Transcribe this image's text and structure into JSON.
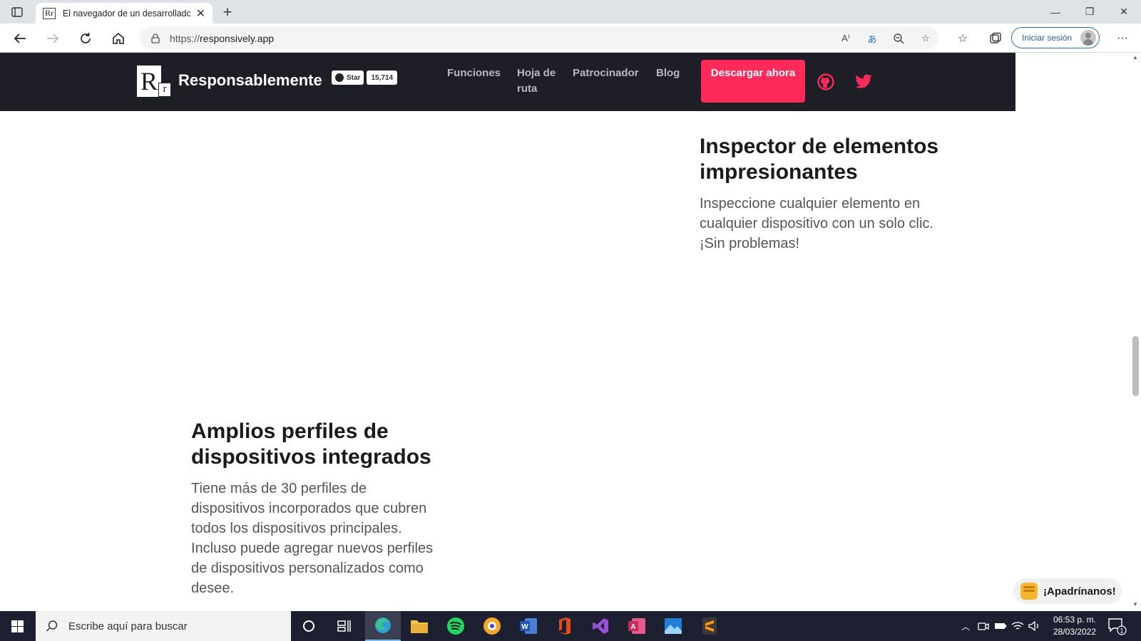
{
  "browser": {
    "tab_title": "El navegador de un desarrollador",
    "url_prefix": "https://",
    "url_host": "responsively.app",
    "signin_label": "Iniciar sesión"
  },
  "site": {
    "brand": "Responsablemente",
    "logo_big": "R",
    "logo_small": "r",
    "star_label": "Star",
    "star_count": "15,714",
    "nav": [
      {
        "label": "Funciones"
      },
      {
        "label": "Hoja de ruta"
      },
      {
        "label": "Patrocinador"
      },
      {
        "label": "Blog"
      }
    ],
    "cta_label": "Descargar ahora"
  },
  "features": [
    {
      "title": "Inspector de elementos impresionantes",
      "text": "Inspeccione cualquier elemento en cualquier dispositivo con un solo clic. ¡Sin problemas!"
    },
    {
      "title": "Amplios perfiles de dispositivos integrados",
      "text": "Tiene más de 30 perfiles de dispositivos incorporados que cubren todos los dispositivos principales. Incluso puede agregar nuevos perfiles de dispositivos personalizados como desee."
    }
  ],
  "sponsor_label": "¡Apadrínanos!",
  "taskbar": {
    "search_placeholder": "Escribe aquí para buscar",
    "time": "06:53 p. m.",
    "date": "28/03/2022",
    "notification_count": "1"
  },
  "colors": {
    "header_bg": "#1e1e27",
    "cta_bg": "#ff2a5a",
    "social_icon": "#ff2a5a",
    "taskbar_bg": "#1c2030"
  }
}
